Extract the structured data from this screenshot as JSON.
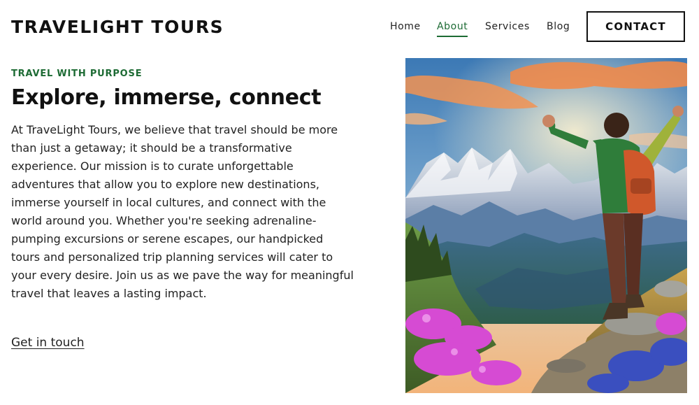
{
  "header": {
    "brand": "TRAVELIGHT TOURS",
    "nav": {
      "home": "Home",
      "about": "About",
      "services": "Services",
      "blog": "Blog"
    },
    "active_nav": "About",
    "contact_label": "CONTACT"
  },
  "main": {
    "kicker": "TRAVEL WITH PURPOSE",
    "headline": "Explore, immerse, connect",
    "body": "At TraveLight Tours, we believe that travel should be more than just a getaway; it should be a transformative experience. Our mission is to curate unforgettable adventures that allow you to explore new destinations, immerse yourself in local cultures, and connect with the world around you. Whether you're seeking adrenaline-pumping excursions or serene escapes, our handpicked tours and personalized trip planning services will cater to your every desire. Join us as we pave the way for meaningful travel that leaves a lasting impact.",
    "cta": "Get in touch"
  },
  "colors": {
    "accent": "#1d6b34",
    "text": "#1a1a1a",
    "background": "#ffffff"
  }
}
